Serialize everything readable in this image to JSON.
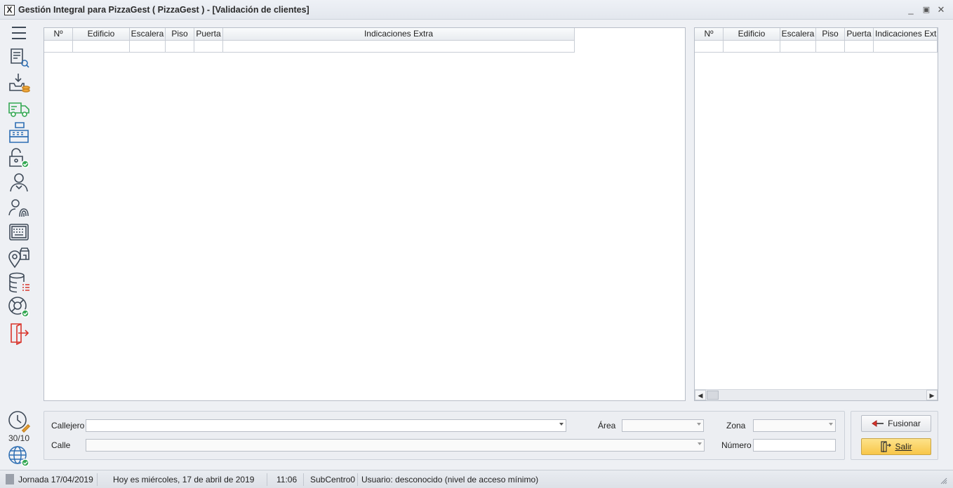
{
  "window": {
    "title": "Gestión Integral para PizzaGest ( PizzaGest ) - [Validación de clientes]",
    "app_icon": "X",
    "minimize_glyph": "_",
    "maximize_glyph": "▣",
    "close_glyph": "✕"
  },
  "sidebar": {
    "items": [
      {
        "icon": "hamburger-menu-icon"
      },
      {
        "icon": "receipt-search-icon"
      },
      {
        "icon": "tray-download-coins-icon"
      },
      {
        "icon": "delivery-truck-icon"
      },
      {
        "icon": "cash-register-icon"
      },
      {
        "icon": "padlock-check-icon"
      },
      {
        "icon": "user-profile-icon"
      },
      {
        "icon": "fingerprint-user-icon"
      },
      {
        "icon": "keyboard-icon"
      },
      {
        "icon": "location-store-icon"
      },
      {
        "icon": "database-list-icon"
      },
      {
        "icon": "lifebuoy-check-icon"
      },
      {
        "icon": "exit-door-icon"
      }
    ],
    "clock_label": "30/10",
    "bottom_icons": [
      "clock-pencil-icon",
      "globe-check-icon"
    ]
  },
  "left_grid": {
    "columns": [
      "Nº",
      "Edificio",
      "Escalera",
      "Piso",
      "Puerta",
      "Indicaciones Extra"
    ]
  },
  "right_grid": {
    "columns": [
      "Nº",
      "Edificio",
      "Escalera",
      "Piso",
      "Puerta",
      "Indicaciones Extra"
    ]
  },
  "form": {
    "callejero_label": "Callejero",
    "callejero_value": "",
    "area_label": "Área",
    "area_value": "",
    "zona_label": "Zona",
    "zona_value": "",
    "calle_label": "Calle",
    "calle_value": "",
    "numero_label": "Número",
    "numero_value": ""
  },
  "buttons": {
    "fusionar_label": "Fusionar",
    "salir_label": "Salir"
  },
  "status": {
    "jornada": "Jornada 17/04/2019",
    "fecha": "Hoy es miércoles, 17 de abril de 2019",
    "hora": "11:06",
    "subcentro": "SubCentro0",
    "usuario": "Usuario: desconocido (nivel de acceso mínimo)"
  },
  "colors": {
    "icon_dark": "#3f4a58",
    "icon_green": "#34a853",
    "icon_orange": "#f2a93b",
    "icon_blue": "#2f6fb3",
    "icon_red": "#d9342b",
    "primary_button": "#f8c648"
  }
}
